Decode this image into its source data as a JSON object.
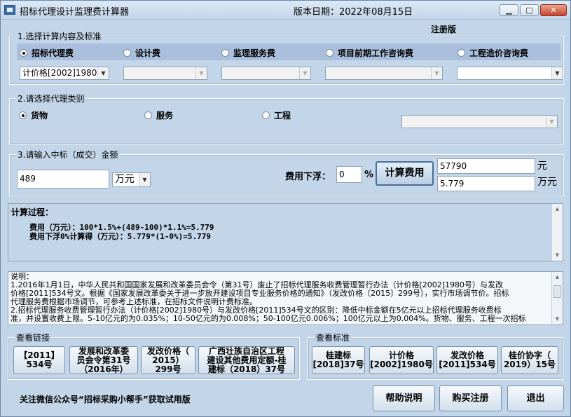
{
  "window": {
    "title": "招标代理设计监理费计算器",
    "version": "版本日期：2022年08月15日",
    "min_glyph": "▁",
    "max_glyph": "□",
    "close_glyph": "✕"
  },
  "registered": "注册版",
  "section1": {
    "title": "1.选择计算内容及标准",
    "radios": [
      {
        "label": "招标代理费",
        "checked": true
      },
      {
        "label": "设计费",
        "checked": false
      },
      {
        "label": "监理服务费",
        "checked": false
      },
      {
        "label": "项目前期工作咨询费",
        "checked": false
      },
      {
        "label": "工程造价咨询费",
        "checked": false
      }
    ],
    "combos": [
      {
        "value": "计价格[2002]1980"
      },
      {
        "value": ""
      },
      {
        "value": ""
      },
      {
        "value": ""
      },
      {
        "value": ""
      }
    ]
  },
  "section2": {
    "title": "2.请选择代理类别",
    "radios": [
      {
        "label": "货物",
        "checked": true
      },
      {
        "label": "服务",
        "checked": false
      },
      {
        "label": "工程",
        "checked": false
      }
    ],
    "combo_value": ""
  },
  "section3": {
    "title": "3.请输入中标（成交）金额",
    "amount": "489",
    "unit_select": "万元",
    "discount_label": "费用下浮：",
    "discount_value": "0",
    "percent": "%",
    "calc_button": "计算费用",
    "result_yuan": "57790",
    "result_yuan_unit": "元",
    "result_wan": "5.779",
    "result_wan_unit": "万元"
  },
  "process": {
    "title": "计算过程：",
    "line1": "费用（万元）：100*1.5%+(489-100)*1.1%=5.779",
    "line2": "费用下浮0%计算得（万元）：5.779*(1-0%)=5.779"
  },
  "notes": {
    "line1": "说明：",
    "line2": "    1.2016年1月1日，中华人民共和国国家发展和改革委员会令（第31号）废止了招标代理服务收费管理暂行办法（计价格[2002]1980号）与发改",
    "line3": "价格[2011]534号文。根据《国家发展改革委关于进一步放开建设项目专业服务价格的通知》（发改价格〔2015〕299号），实行市场调节价。招标",
    "line4": "代理服务费根据市场调节，可参考上述标准，在招标文件说明计费标准。",
    "line5": "    2.招标代理服务收费管理暂行办法（计价格[2002]1980号）与发改价格[2011]534号文的区别：降低中标金额在5亿元以上招标代理服务收费标",
    "line6": "准，并设置收费上限。5-10亿元的为0.035%；10-50亿元的为0.008%；50-100亿元0.006%；100亿元以上为0.004%。货物、服务、工程一次招标"
  },
  "links": {
    "title": "查看链接",
    "buttons": [
      "【2011】\n534号",
      "发展和改革委\n员会令第31号\n（2016年）",
      "发改价格（\n2015）\n299号",
      "广西壮族自治区工程\n建设其他费用定额-桂\n建标（2018）37号"
    ]
  },
  "standards": {
    "title": "查看标准",
    "buttons": [
      "桂建标\n[2018]37号",
      "计价格\n[2002]1980号",
      "发改价格\n[2011]534号",
      "桂价协字（\n2019）15号"
    ]
  },
  "footer": {
    "notice": "关注微信公众号“招标采购小帮手”获取试用版",
    "help": "帮助说明",
    "buy": "购买注册",
    "exit": "退出"
  }
}
